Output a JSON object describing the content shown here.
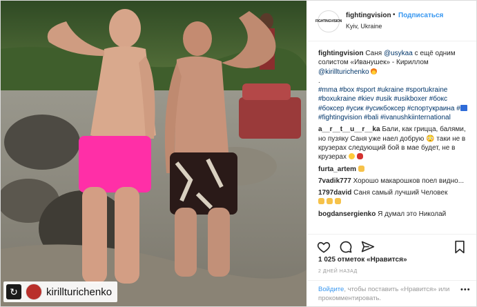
{
  "post": {
    "repost_badge": "↻",
    "repost_username": "kirillturichenko"
  },
  "header": {
    "avatar_text": "FIGHTINGVISION",
    "username": "fightingvision",
    "dot": "•",
    "follow_label": "Подписаться",
    "location": "Kyiv, Ukraine"
  },
  "caption": {
    "username": "fightingvision",
    "text_1": "Саня ",
    "mention_1": "@usykaa",
    "text_2": " с ещё одним солистом «Иванушек» - Кириллом ",
    "mention_2": "@kirillturichenko",
    "dot_line": ".",
    "hashtags_1": "#mma #box #sport #ukraine #sportukraine #boxukraine #kiev #usik #usikboxer #бокс #боксер #усик #усикбоксер #спортукраина #",
    "hashtags_2": " #fightingvision #bali #ivanushkiinternational"
  },
  "comments": [
    {
      "username": "a__r__t__u__r__ka",
      "text": "Бали, как грицца, балями, но пузяку Саня уже наел добрую 😳 таки не в крузерах следующий бой в мае будет, не в крузерах"
    },
    {
      "username": "furta_artem",
      "text": ""
    },
    {
      "username": "7vadik777",
      "text": "Хорошо макарошков поел видно..."
    },
    {
      "username": "1797david",
      "text": "Саня самый лучший Человек"
    },
    {
      "username": "bogdansergienko",
      "text": "Я думал это Николай"
    }
  ],
  "stats": {
    "likes": "1 025 отметок «Нравится»",
    "date": "2 дней назад"
  },
  "login_prompt": {
    "link_1": "Войдите",
    "text_1": ", чтобы поставить «Нравится» или прокомментировать.",
    "more": "•••"
  },
  "icons": {
    "like": "heart-icon",
    "comment": "comment-icon",
    "share": "share-icon",
    "save": "bookmark-icon"
  }
}
